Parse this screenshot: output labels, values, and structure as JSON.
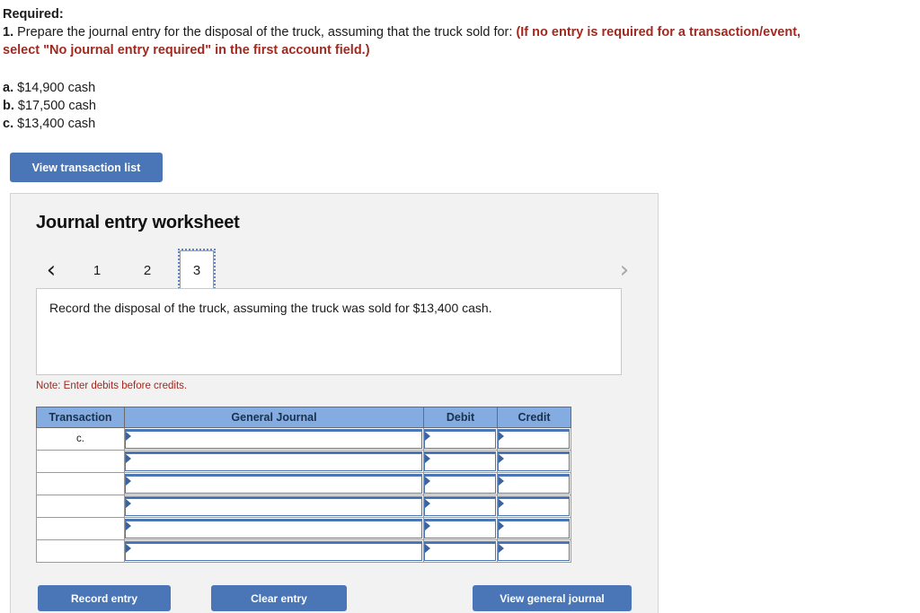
{
  "question": {
    "required_label": "Required:",
    "number": "1.",
    "prompt": " Prepare the journal entry for the disposal of the truck, assuming that the truck sold for: ",
    "red_note": "(If no entry is required for a transaction/event, select \"No journal entry required\" in the first account field.)",
    "choices": [
      {
        "letter": "a.",
        "text": " $14,900 cash"
      },
      {
        "letter": "b.",
        "text": " $17,500 cash"
      },
      {
        "letter": "c.",
        "text": " $13,400 cash"
      }
    ]
  },
  "toolbar": {
    "view_transaction_list_label": "View transaction list"
  },
  "worksheet": {
    "title": "Journal entry worksheet",
    "pager": {
      "prev_icon": "chevron-left",
      "prev_glyph": "‹",
      "next_icon": "chevron-right",
      "next_glyph": "›",
      "tabs": [
        "1",
        "2",
        "3"
      ],
      "active_tab": "3"
    },
    "instruction": "Record the disposal of the truck, assuming the truck was sold for $13,400 cash.",
    "note": "Note: Enter debits before credits.",
    "table": {
      "columns": [
        "Transaction",
        "General Journal",
        "Debit",
        "Credit"
      ],
      "rows": [
        {
          "transaction": "c.",
          "general_journal": "",
          "debit": "",
          "credit": ""
        },
        {
          "transaction": "",
          "general_journal": "",
          "debit": "",
          "credit": ""
        },
        {
          "transaction": "",
          "general_journal": "",
          "debit": "",
          "credit": ""
        },
        {
          "transaction": "",
          "general_journal": "",
          "debit": "",
          "credit": ""
        },
        {
          "transaction": "",
          "general_journal": "",
          "debit": "",
          "credit": ""
        },
        {
          "transaction": "",
          "general_journal": "",
          "debit": "",
          "credit": ""
        }
      ]
    },
    "actions": {
      "record_entry_label": "Record entry",
      "clear_entry_label": "Clear entry",
      "view_general_journal_label": "View general journal"
    }
  },
  "colors": {
    "accent_blue": "#4a76b8",
    "header_blue": "#84ace0",
    "alert_red": "#a2291f",
    "panel_gray": "#f2f2f2"
  }
}
